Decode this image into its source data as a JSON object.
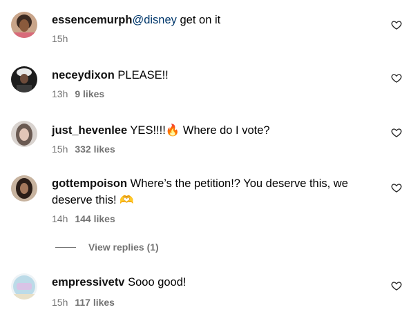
{
  "comments": [
    {
      "username": "essencemurph",
      "mention": "@disney",
      "text": " get on it",
      "time": "15h",
      "likes": ""
    },
    {
      "username": "neceydixon",
      "text": " PLEASE!!",
      "time": "13h",
      "likes": "9 likes"
    },
    {
      "username": "just_hevenlee",
      "text": " YES!!!!",
      "emoji": "🔥",
      "text2": " Where do I vote?",
      "time": "15h",
      "likes": "332 likes"
    },
    {
      "username": "gottempoison",
      "text": " Where’s the petition!? You deserve this, we deserve this! ",
      "emoji": "🫶",
      "time": "14h",
      "likes": "144 likes"
    },
    {
      "username": "empressivetv",
      "text": " Sooo good!",
      "time": "15h",
      "likes": "117 likes"
    }
  ],
  "view_replies": "View replies (1)",
  "icons": {
    "like": "heart-outline-icon",
    "avatar": "profile-picture"
  }
}
